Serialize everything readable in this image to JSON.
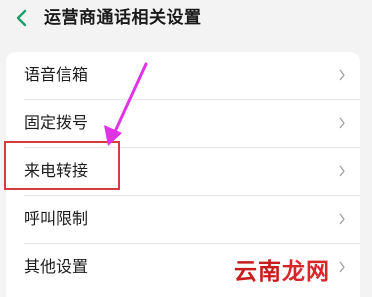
{
  "header": {
    "title": "运营商通话相关设置",
    "back_icon": "chevron-left-icon"
  },
  "settings": {
    "items": [
      {
        "label": "语音信箱"
      },
      {
        "label": "固定拨号"
      },
      {
        "label": "来电转接"
      },
      {
        "label": "呼叫限制"
      },
      {
        "label": "其他设置"
      }
    ],
    "highlighted": "来电转接"
  },
  "watermark": {
    "text_a": "云南",
    "text_b": "龙网"
  },
  "colors": {
    "accent": "#1f9e6b",
    "highlight": "#d83b3b",
    "arrow": "#e033e6"
  }
}
